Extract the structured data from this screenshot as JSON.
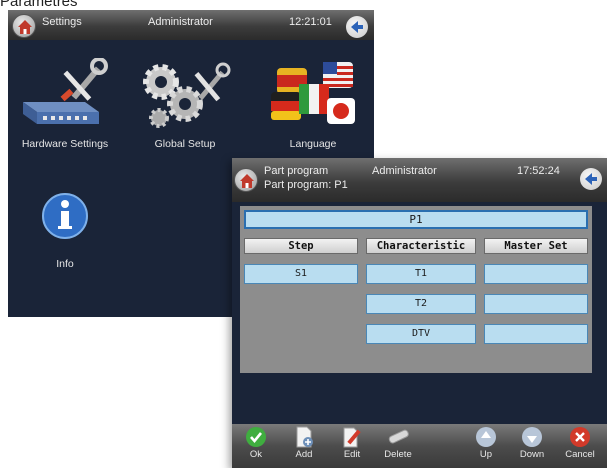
{
  "page_heading": "Paramètres",
  "settings_window": {
    "title": "Settings",
    "user": "Administrator",
    "time": "12:21:01",
    "tiles": [
      {
        "label": "Hardware Settings",
        "icon": "hardware-tools-icon"
      },
      {
        "label": "Global Setup",
        "icon": "gears-icon"
      },
      {
        "label": "Language",
        "icon": "flags-icon"
      },
      {
        "label": "Info",
        "icon": "info-icon"
      }
    ]
  },
  "part_window": {
    "title": "Part program",
    "subtitle": "Part program: P1",
    "user": "Administrator",
    "time": "17:52:24",
    "program_name": "P1",
    "columns": [
      "Step",
      "Characteristic",
      "Master Set"
    ],
    "steps": [
      "S1"
    ],
    "characteristics": [
      "T1",
      "T2",
      "DTV"
    ],
    "master_sets": [
      "",
      "",
      ""
    ],
    "toolbar": [
      {
        "label": "Ok",
        "icon": "ok-check-icon"
      },
      {
        "label": "Add",
        "icon": "add-page-icon"
      },
      {
        "label": "Edit",
        "icon": "edit-pencil-icon"
      },
      {
        "label": "Delete",
        "icon": "delete-eraser-icon"
      },
      {
        "label": "Up",
        "icon": "arrow-up-icon"
      },
      {
        "label": "Down",
        "icon": "arrow-down-icon"
      },
      {
        "label": "Cancel",
        "icon": "cancel-x-icon"
      }
    ]
  },
  "colors": {
    "window_bg": "#1a2438",
    "cell_bg": "#b9ddf0",
    "cell_border": "#4a87b6",
    "ok_green": "#3fae3f",
    "cancel_red": "#d23a2a"
  }
}
